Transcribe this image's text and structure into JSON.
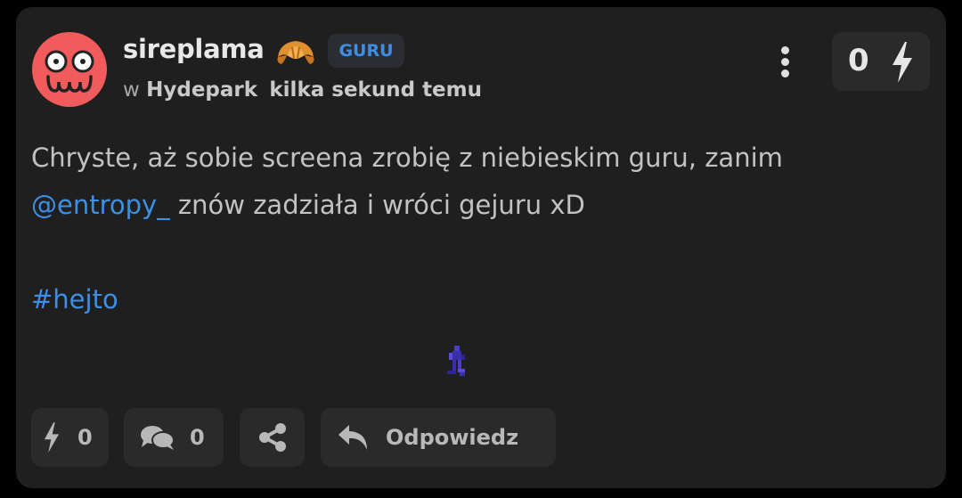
{
  "post": {
    "author": "sireplama",
    "badge": "GURU",
    "meta_prefix": "w",
    "community": "Hydepark",
    "time": "kilka sekund temu",
    "score": "0",
    "content_line1": "Chryste, aż sobie screena zrobię z niebieskim guru, zanim",
    "mention": "@entropy_",
    "content_line2_rest": " znów zadziała i wróci gejuru xD",
    "hashtag": "#hejto"
  },
  "actions": {
    "like_count": "0",
    "comment_count": "0",
    "reply_label": "Odpowiedz"
  },
  "colors": {
    "background": "#000000",
    "card": "#1f1f1f",
    "button": "#2a2a2a",
    "accent_blue": "#3d8fe6",
    "avatar": "#f15b5b"
  },
  "icons": [
    "avatar-face-icon",
    "croissant-icon",
    "kebab-menu-icon",
    "bolt-icon",
    "comments-icon",
    "share-icon",
    "reply-icon"
  ]
}
